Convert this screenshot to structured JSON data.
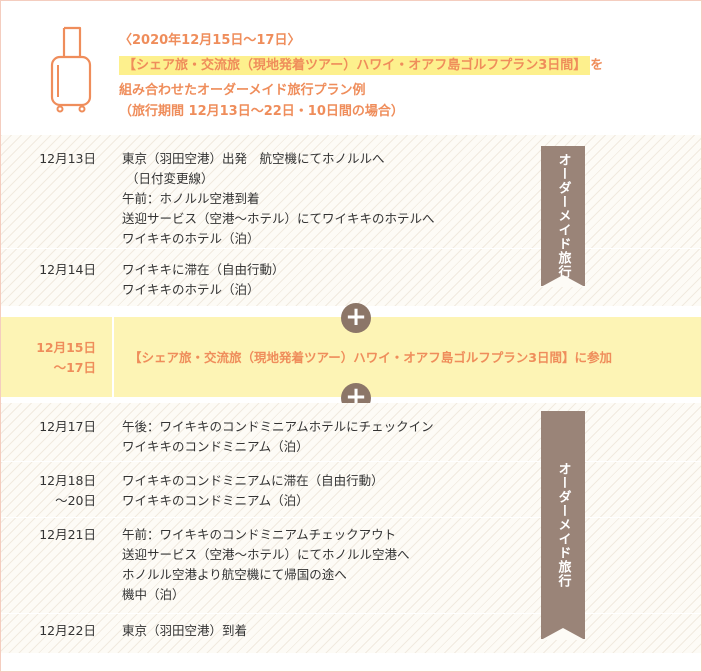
{
  "header": {
    "line1": "〈2020年12月15日〜17日〉",
    "line2_highlight": "【シェア旅・交流旅（現地発着ツアー）ハワイ・オアフ島ゴルフプラン3日間】",
    "line2_suffix": "を",
    "line3": "組み合わせたオーダーメイド旅行プラン例",
    "line4": "（旅行期間 12月13日〜22日・10日間の場合）",
    "icon": "suitcase-icon"
  },
  "tag_label": "オーダーメイド旅行",
  "block1": [
    {
      "date": "12月13日",
      "lines": [
        "東京（羽田空港）出発　航空機にてホノルルへ",
        "（日付変更線）",
        "午前：ホノルル空港到着",
        "送迎サービス（空港〜ホテル）にてワイキキのホテルへ",
        "ワイキキのホテル（泊）"
      ]
    },
    {
      "date": "12月14日",
      "lines": [
        "ワイキキに滞在（自由行動）",
        "ワイキキのホテル（泊）"
      ]
    }
  ],
  "tour": {
    "date_line1": "12月15日",
    "date_line2": "〜17日",
    "text": "【シェア旅・交流旅（現地発着ツアー）ハワイ・オアフ島ゴルフプラン3日間】に参加"
  },
  "block2": [
    {
      "date": "12月17日",
      "date2": "",
      "lines": [
        "午後：ワイキキのコンドミニアムホテルにチェックイン",
        "ワイキキのコンドミニアム（泊）"
      ]
    },
    {
      "date": "12月18日",
      "date2": "〜20日",
      "lines": [
        "ワイキキのコンドミニアムに滞在（自由行動）",
        "ワイキキのコンドミニアム（泊）"
      ]
    },
    {
      "date": "12月21日",
      "date2": "",
      "lines": [
        "午前：ワイキキのコンドミニアムチェックアウト",
        "送迎サービス（空港〜ホテル）にてホノルル空港へ",
        "ホノルル空港より航空機にて帰国の途へ",
        "機中（泊）"
      ]
    },
    {
      "date": "12月22日",
      "date2": "",
      "lines": [
        "東京（羽田空港）到着"
      ]
    }
  ],
  "plus_symbol": "+",
  "colors": {
    "accent": "#ef8d5b",
    "tag": "#9a8478",
    "highlight": "#fdf08d",
    "tour_band": "#fdf4b5",
    "border": "#f4cdbf"
  }
}
